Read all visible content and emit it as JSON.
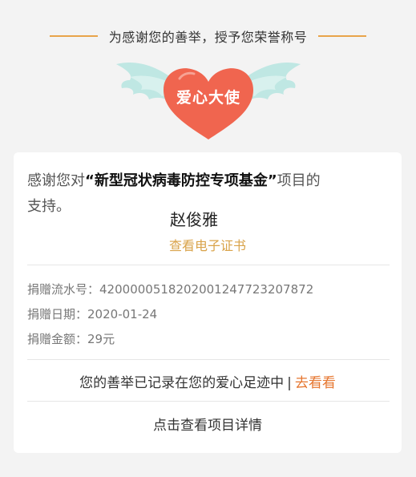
{
  "honor": {
    "text": "为感谢您的善举，授予您荣誉称号"
  },
  "badge": {
    "label": "爱心大使",
    "heart_color": "#f0654f",
    "wing_color": "#bfe7e3"
  },
  "card": {
    "project_prefix": "感谢您对",
    "project_name": "“新型冠状病毒防控专项基金”",
    "project_suffix_line1": "项目的",
    "project_suffix_line2": "支持。",
    "donor_name": "赵俊雅",
    "view_certificate": "查看电子证书",
    "info": [
      {
        "label": "捐赠流水号：",
        "value": "420000051820200124772320787 2"
      },
      {
        "label": "捐赠日期：",
        "value": "2020-01-24"
      },
      {
        "label": "捐赠金额：",
        "value": "29元"
      }
    ],
    "footprint": {
      "text": "您的善举已记录在您的爱心足迹中",
      "separator": "|",
      "link": "去看看"
    },
    "project_details": "点击查看项目详情"
  },
  "colors": {
    "accent_gold": "#d9a34a",
    "link_orange": "#e6762f",
    "heart_red": "#f0654f"
  }
}
